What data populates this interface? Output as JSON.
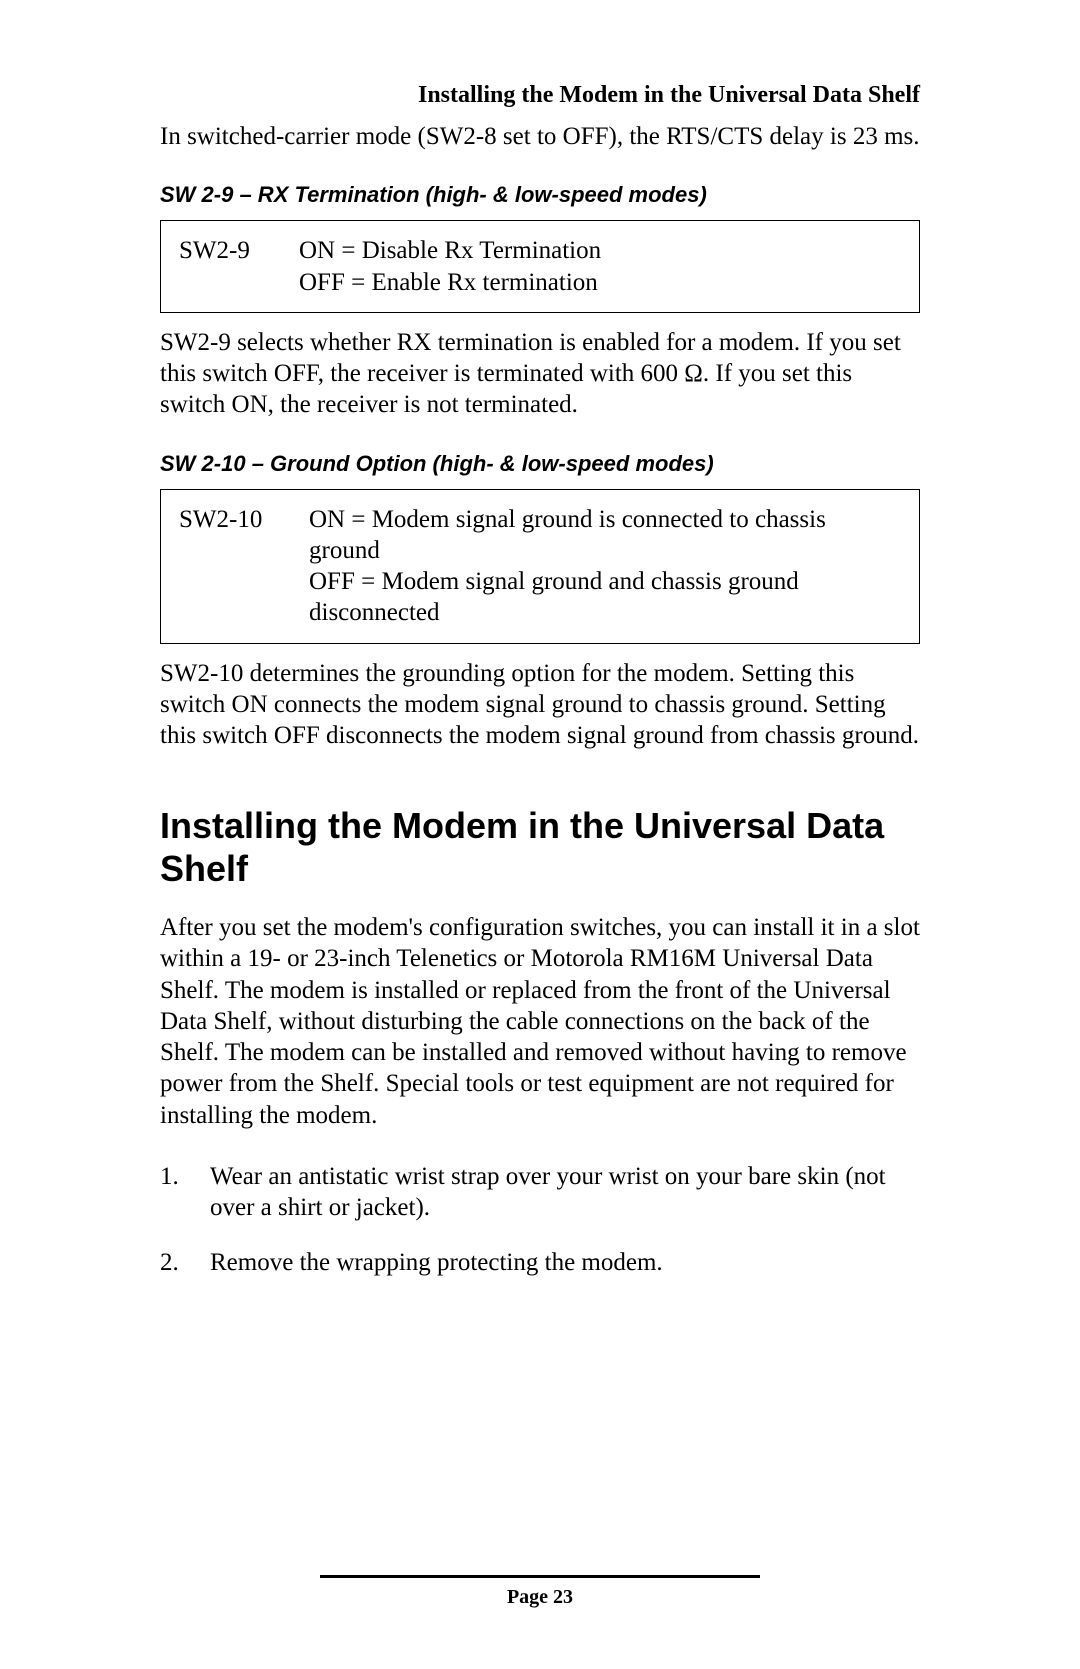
{
  "header": {
    "title": "Installing the Modem in the Universal Data Shelf"
  },
  "intro_paragraph": "In switched-carrier mode (SW2-8 set to OFF), the RTS/CTS delay is 23 ms.",
  "section1": {
    "label": "SW 2-9 – RX Termination (high- & low-speed modes)",
    "switch": "SW2-9",
    "on_line": "ON = Disable Rx Termination",
    "off_line": "OFF = Enable Rx termination",
    "description": "SW2-9 selects whether RX termination is enabled for a modem. If you set this switch OFF, the receiver is terminated with 600 Ω. If you set this switch ON, the receiver is not terminated."
  },
  "section2": {
    "label": "SW 2-10 – Ground Option (high- & low-speed modes)",
    "switch": "SW2-10",
    "on_line": "ON = Modem signal ground is connected to chassis ground",
    "off_line": "OFF = Modem signal ground and chassis ground disconnected",
    "description": "SW2-10 determines the grounding option for the modem. Setting this switch ON connects the modem signal ground to chassis ground. Setting this switch OFF disconnects the modem signal ground from chassis ground."
  },
  "install": {
    "heading": "Installing the Modem in the Universal Data Shelf",
    "paragraph": "After you set the modem's configuration switches, you can install it in a slot within a 19- or 23-inch Telenetics or Motorola RM16M Universal Data Shelf. The modem is installed or replaced from the front of the Universal Data Shelf, without disturbing the cable connections on the back of the Shelf. The modem can be installed and removed without having to remove power from the Shelf. Special tools or test equipment are not required for installing the modem.",
    "steps": [
      "Wear an antistatic wrist strap over your wrist on your bare skin (not over a shirt or jacket).",
      "Remove the wrapping protecting the modem."
    ]
  },
  "footer": {
    "page_label": "Page 23"
  }
}
